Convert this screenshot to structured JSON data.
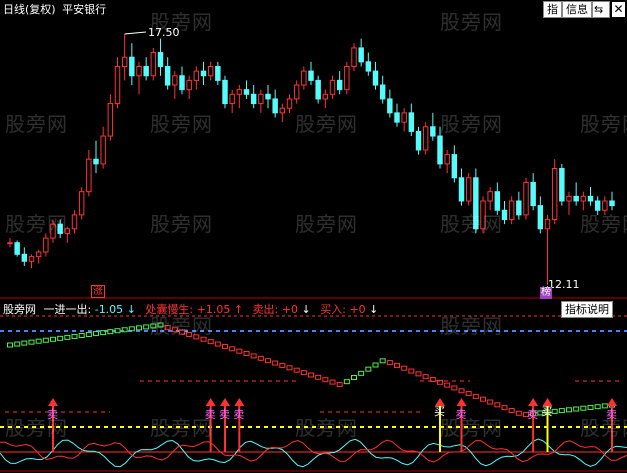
{
  "header": {
    "period_label": "日线(复权)",
    "stock_name": "平安银行"
  },
  "toolbar": {
    "index_button": "指",
    "info_button": "信息",
    "arrow_button": "⇆"
  },
  "indicator_bar": {
    "name": "股旁网",
    "items": [
      {
        "label": "一进一出:",
        "value": "-1.05",
        "arrow": "↓"
      },
      {
        "label": "处囊慢生:",
        "value": "+1.05",
        "arrow": "↑"
      },
      {
        "label": "卖出:",
        "value": "+0",
        "arrow": "↓"
      },
      {
        "label": "买入:",
        "value": "+0",
        "arrow": "↓"
      }
    ],
    "help_button": "指标说明"
  },
  "annotations": {
    "high_price": "17.50",
    "low_price": "12.11",
    "rise_marker": "涨",
    "bottom_marker": "榜"
  },
  "signals": {
    "sell": "卖",
    "buy": "买"
  },
  "watermark": "股旁网",
  "colors": {
    "up": "#ff3232",
    "down": "#54fcfc",
    "ma_white": "#ffffff",
    "blue_dash": "#4f7fff",
    "red_dash": "#ff3232",
    "yellow_dash": "#ffff00",
    "green_step": "#4ff04f",
    "red_step": "#ff3232"
  },
  "chart_data": {
    "type": "candlestick",
    "y_axis_visible": false,
    "candles": [
      [
        13.0,
        13.1,
        12.9,
        13.0
      ],
      [
        13.0,
        13.05,
        12.7,
        12.75
      ],
      [
        12.75,
        12.9,
        12.5,
        12.6
      ],
      [
        12.6,
        12.75,
        12.45,
        12.7
      ],
      [
        12.7,
        12.85,
        12.55,
        12.8
      ],
      [
        12.8,
        13.2,
        12.7,
        13.1
      ],
      [
        13.1,
        13.5,
        13.0,
        13.4
      ],
      [
        13.4,
        13.5,
        13.1,
        13.2
      ],
      [
        13.2,
        13.35,
        13.0,
        13.3
      ],
      [
        13.3,
        13.7,
        13.2,
        13.6
      ],
      [
        13.6,
        14.2,
        13.5,
        14.1
      ],
      [
        14.1,
        15.0,
        14.0,
        14.8
      ],
      [
        14.8,
        15.2,
        14.5,
        14.7
      ],
      [
        14.7,
        15.5,
        14.6,
        15.3
      ],
      [
        15.3,
        16.2,
        15.2,
        16.0
      ],
      [
        16.0,
        17.0,
        15.9,
        16.8
      ],
      [
        16.8,
        17.5,
        16.5,
        17.0
      ],
      [
        17.0,
        17.3,
        16.4,
        16.6
      ],
      [
        16.6,
        16.9,
        16.2,
        16.8
      ],
      [
        16.8,
        17.0,
        16.5,
        16.6
      ],
      [
        16.6,
        17.2,
        16.5,
        17.1
      ],
      [
        17.1,
        17.4,
        16.6,
        16.8
      ],
      [
        16.8,
        17.0,
        16.3,
        16.4
      ],
      [
        16.4,
        16.7,
        16.1,
        16.6
      ],
      [
        16.6,
        16.8,
        16.2,
        16.3
      ],
      [
        16.3,
        16.6,
        16.1,
        16.5
      ],
      [
        16.5,
        16.8,
        16.3,
        16.7
      ],
      [
        16.7,
        16.9,
        16.4,
        16.6
      ],
      [
        16.6,
        16.9,
        16.5,
        16.8
      ],
      [
        16.8,
        16.9,
        16.4,
        16.5
      ],
      [
        16.5,
        16.6,
        15.9,
        16.0
      ],
      [
        16.0,
        16.3,
        15.8,
        16.2
      ],
      [
        16.2,
        16.4,
        15.9,
        16.3
      ],
      [
        16.3,
        16.5,
        16.1,
        16.2
      ],
      [
        16.2,
        16.4,
        15.9,
        16.0
      ],
      [
        16.0,
        16.3,
        15.8,
        16.2
      ],
      [
        16.2,
        16.4,
        15.9,
        16.1
      ],
      [
        16.1,
        16.3,
        15.7,
        15.8
      ],
      [
        15.8,
        16.0,
        15.6,
        15.9
      ],
      [
        15.9,
        16.2,
        15.8,
        16.1
      ],
      [
        16.1,
        16.5,
        16.0,
        16.4
      ],
      [
        16.4,
        16.8,
        16.3,
        16.7
      ],
      [
        16.7,
        16.9,
        16.4,
        16.5
      ],
      [
        16.5,
        16.6,
        16.0,
        16.1
      ],
      [
        16.1,
        16.3,
        15.9,
        16.2
      ],
      [
        16.2,
        16.6,
        16.1,
        16.5
      ],
      [
        16.5,
        16.7,
        16.2,
        16.3
      ],
      [
        16.3,
        16.9,
        16.2,
        16.8
      ],
      [
        16.8,
        17.3,
        16.7,
        17.2
      ],
      [
        17.2,
        17.4,
        16.8,
        16.9
      ],
      [
        16.9,
        17.1,
        16.6,
        16.7
      ],
      [
        16.7,
        16.9,
        16.3,
        16.4
      ],
      [
        16.4,
        16.6,
        16.0,
        16.1
      ],
      [
        16.1,
        16.3,
        15.7,
        15.8
      ],
      [
        15.8,
        16.0,
        15.5,
        15.6
      ],
      [
        15.6,
        15.9,
        15.4,
        15.8
      ],
      [
        15.8,
        16.0,
        15.3,
        15.4
      ],
      [
        15.4,
        15.5,
        14.9,
        15.0
      ],
      [
        15.0,
        15.6,
        14.9,
        15.5
      ],
      [
        15.5,
        15.8,
        15.2,
        15.3
      ],
      [
        15.3,
        15.5,
        14.6,
        14.7
      ],
      [
        14.7,
        15.0,
        14.5,
        14.9
      ],
      [
        14.9,
        15.1,
        14.3,
        14.4
      ],
      [
        14.4,
        14.6,
        13.8,
        13.9
      ],
      [
        13.9,
        14.5,
        13.8,
        14.4
      ],
      [
        14.4,
        14.6,
        13.2,
        13.3
      ],
      [
        13.3,
        14.0,
        13.2,
        13.9
      ],
      [
        13.9,
        14.2,
        13.7,
        14.1
      ],
      [
        14.1,
        14.3,
        13.6,
        13.7
      ],
      [
        13.7,
        13.9,
        13.4,
        13.5
      ],
      [
        13.5,
        14.0,
        13.4,
        13.9
      ],
      [
        13.9,
        14.1,
        13.5,
        13.6
      ],
      [
        13.6,
        14.4,
        13.5,
        14.3
      ],
      [
        14.3,
        14.5,
        13.7,
        13.8
      ],
      [
        13.8,
        14.0,
        13.2,
        13.3
      ],
      [
        13.3,
        13.6,
        12.11,
        13.5
      ],
      [
        13.5,
        14.8,
        13.4,
        14.6
      ],
      [
        14.6,
        14.7,
        13.8,
        13.9
      ],
      [
        13.9,
        14.1,
        13.6,
        14.0
      ],
      [
        14.0,
        14.3,
        13.8,
        13.9
      ],
      [
        13.9,
        14.1,
        13.7,
        14.0
      ],
      [
        14.0,
        14.2,
        13.8,
        13.9
      ],
      [
        13.9,
        14.0,
        13.6,
        13.7
      ],
      [
        13.7,
        14.0,
        13.6,
        13.9
      ],
      [
        13.9,
        14.1,
        13.7,
        13.8
      ]
    ],
    "sell_signal_indices": [
      6,
      28,
      30,
      32,
      63,
      73,
      84
    ],
    "buy_signal_indices": [
      60,
      75
    ]
  }
}
